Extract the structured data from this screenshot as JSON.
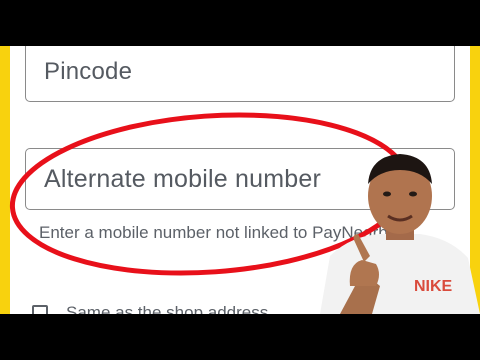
{
  "form": {
    "pincode_placeholder": "Pincode",
    "alternate_mobile_placeholder": "Alternate mobile number",
    "helper_text": "Enter a mobile number not linked to PayNearby",
    "checkbox_label": "Same as the shop address"
  },
  "overlay": {
    "shirt_text": "NIKE"
  },
  "colors": {
    "background_yellow": "#f8d20e",
    "annotation_red": "#e8101a",
    "field_border": "#8a8a8a",
    "text_gray": "#5c6168"
  }
}
